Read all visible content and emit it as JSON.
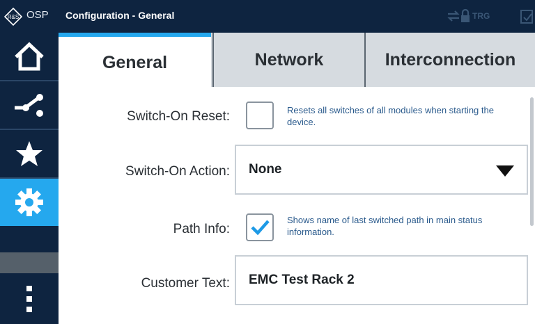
{
  "titlebar": {
    "logo_text": "R&S",
    "app_name": "OSP",
    "window_title": "Configuration - General",
    "trg_label": "TRG",
    "icons": [
      "arrows-icon",
      "lock-icon",
      "check-window-icon"
    ]
  },
  "sidebar": {
    "items": [
      {
        "icon": "home-icon"
      },
      {
        "icon": "path-switch-icon"
      },
      {
        "icon": "star-icon"
      },
      {
        "icon": "gear-icon",
        "active": true
      },
      {
        "icon": "more-vertical-icon"
      }
    ]
  },
  "tabs": [
    {
      "label": "General",
      "active": true
    },
    {
      "label": "Network"
    },
    {
      "label": "Interconnection"
    }
  ],
  "form": {
    "switch_on_reset": {
      "label": "Switch-On Reset:",
      "checked": false,
      "description": "Resets all switches of all modules when starting the device."
    },
    "switch_on_action": {
      "label": "Switch-On Action:",
      "value": "None"
    },
    "path_info": {
      "label": "Path Info:",
      "checked": true,
      "description": "Shows name of last switched path in main status information."
    },
    "customer_text": {
      "label": "Customer Text:",
      "value": "EMC Test Rack 2"
    }
  },
  "colors": {
    "dark_navy": "#0e2440",
    "accent_blue": "#25a8ee",
    "tab_inactive": "#d6dbe0",
    "description_blue": "#2a5a8c"
  }
}
